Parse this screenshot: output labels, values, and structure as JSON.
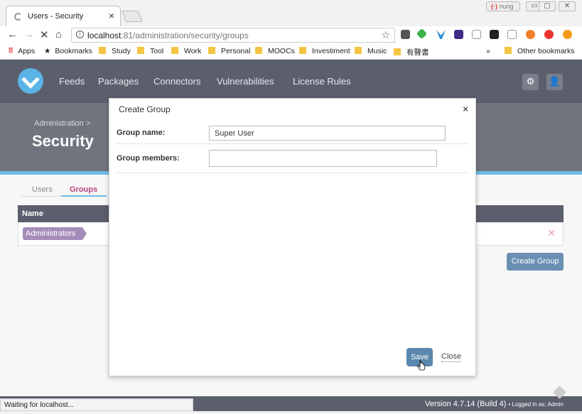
{
  "browser": {
    "tab_title": "Users - Security",
    "tab_close": "×",
    "user_name": "nung",
    "win_min": "▭",
    "win_max": "▢",
    "win_close": "✕",
    "url_host": "localhost",
    "url_path": ":81/administration/security/groups",
    "bookmarks": [
      {
        "label": "Apps",
        "icon": "apps-grid-icon"
      },
      {
        "label": "Bookmarks",
        "icon": "star-icon"
      },
      {
        "label": "Study",
        "icon": "folder-icon"
      },
      {
        "label": "Tool",
        "icon": "folder-icon"
      },
      {
        "label": "Work",
        "icon": "folder-icon"
      },
      {
        "label": "Personal",
        "icon": "folder-icon"
      },
      {
        "label": "MOOCs",
        "icon": "folder-icon"
      },
      {
        "label": "Investiment",
        "icon": "folder-icon"
      },
      {
        "label": "Music",
        "icon": "folder-icon"
      },
      {
        "label": "有聲書",
        "icon": "folder-icon"
      }
    ],
    "overflow": "»",
    "other_bookmarks": "Other bookmarks",
    "status_text": "Waiting for localhost..."
  },
  "app": {
    "nav": [
      "Feeds",
      "Packages",
      "Connectors",
      "Vulnerabilities",
      "License Rules"
    ],
    "breadcrumb": "Administration >",
    "page_title": "Security",
    "tabs": [
      {
        "label": "Users",
        "active": false
      },
      {
        "label": "Groups",
        "active": true
      }
    ],
    "table": {
      "headers": [
        "Name"
      ],
      "rows": [
        {
          "name": "Administrators"
        }
      ]
    },
    "create_group_button": "Create Group",
    "version": "Version 4.7.14 (Build 4)",
    "logged_in": "• Logged in as: Admin"
  },
  "modal": {
    "title": "Create Group",
    "close": "×",
    "group_name_label": "Group name:",
    "group_name_value": "Super User",
    "members_label": "Group members:",
    "members_value": "",
    "save": "Save",
    "close_button": "Close"
  },
  "colors": {
    "nav_bg": "#5b5e6c",
    "accent_blue": "#6fb9e6",
    "tag_purple": "#a58dba",
    "primary_button": "#5a87ad"
  }
}
